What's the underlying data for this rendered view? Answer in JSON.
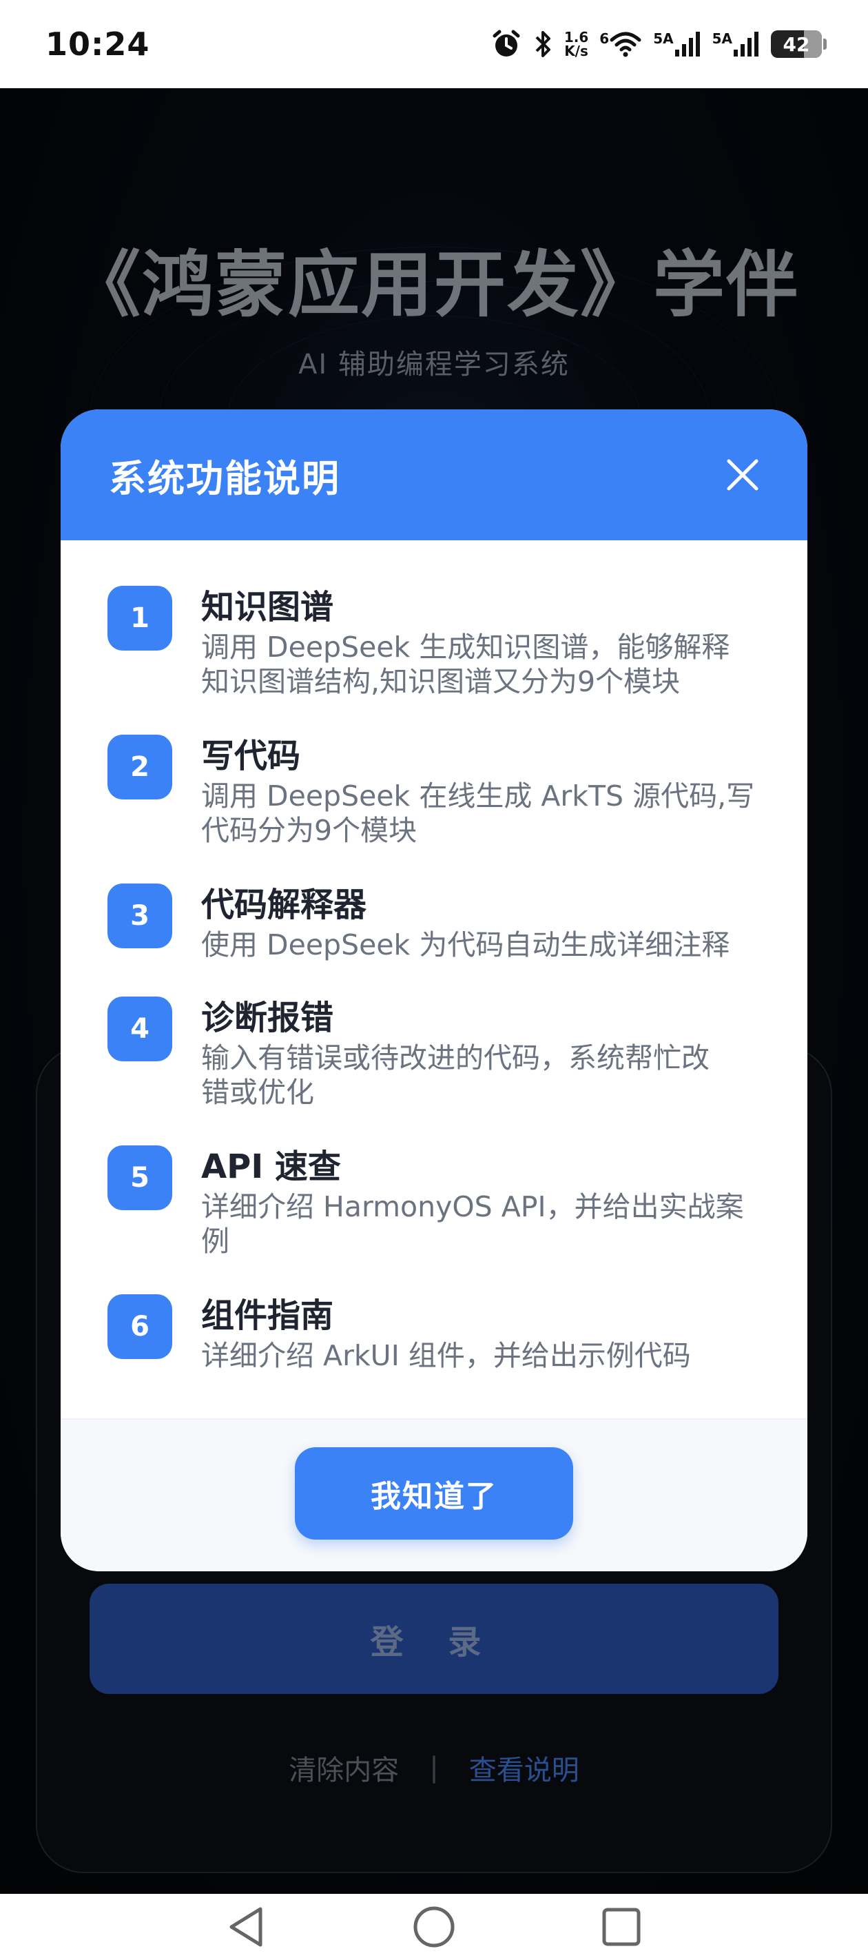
{
  "status_bar": {
    "time": "10:24",
    "network_speed": "1.6\nK/s",
    "wifi_label": "6",
    "sim1_label": "5A",
    "sim2_label": "5A",
    "battery": "42",
    "icons": [
      "alarm-icon",
      "bluetooth-icon",
      "network-speed",
      "wifi-icon",
      "signal-icon",
      "signal-icon",
      "battery-icon"
    ]
  },
  "app": {
    "title": "《鸿蒙应用开发》学伴",
    "subtitle": "AI 辅助编程学习系统",
    "login_label": "登 录",
    "clear_link": "清除内容",
    "separator": "|",
    "view_link": "查看说明"
  },
  "dialog": {
    "title": "系统功能说明",
    "features": [
      {
        "num": "1",
        "name": "知识图谱",
        "desc_lines": [
          "调用 DeepSeek 生成知识图谱，能够解释",
          "知识图谱结构,知识图谱又分为9个模块"
        ]
      },
      {
        "num": "2",
        "name": "写代码",
        "desc_lines": [
          "调用 DeepSeek 在线生成 ArkTS 源代码,写",
          "代码分为9个模块"
        ]
      },
      {
        "num": "3",
        "name": "代码解释器",
        "desc_lines": [
          "使用 DeepSeek 为代码自动生成详细注释"
        ]
      },
      {
        "num": "4",
        "name": "诊断报错",
        "desc_lines": [
          "输入有错误或待改进的代码，系统帮忙改",
          "错或优化"
        ]
      },
      {
        "num": "5",
        "name": "API 速查",
        "desc_lines": [
          "详细介绍 HarmonyOS API，并给出实战案",
          "例"
        ]
      },
      {
        "num": "6",
        "name": "组件指南",
        "desc_lines": [
          "详细介绍 ArkUI 组件，并给出示例代码"
        ]
      }
    ],
    "ok_label": "我知道了"
  },
  "colors": {
    "accent": "#3b82f6",
    "title_text": "#1f2430",
    "desc_text": "#6b7280"
  }
}
